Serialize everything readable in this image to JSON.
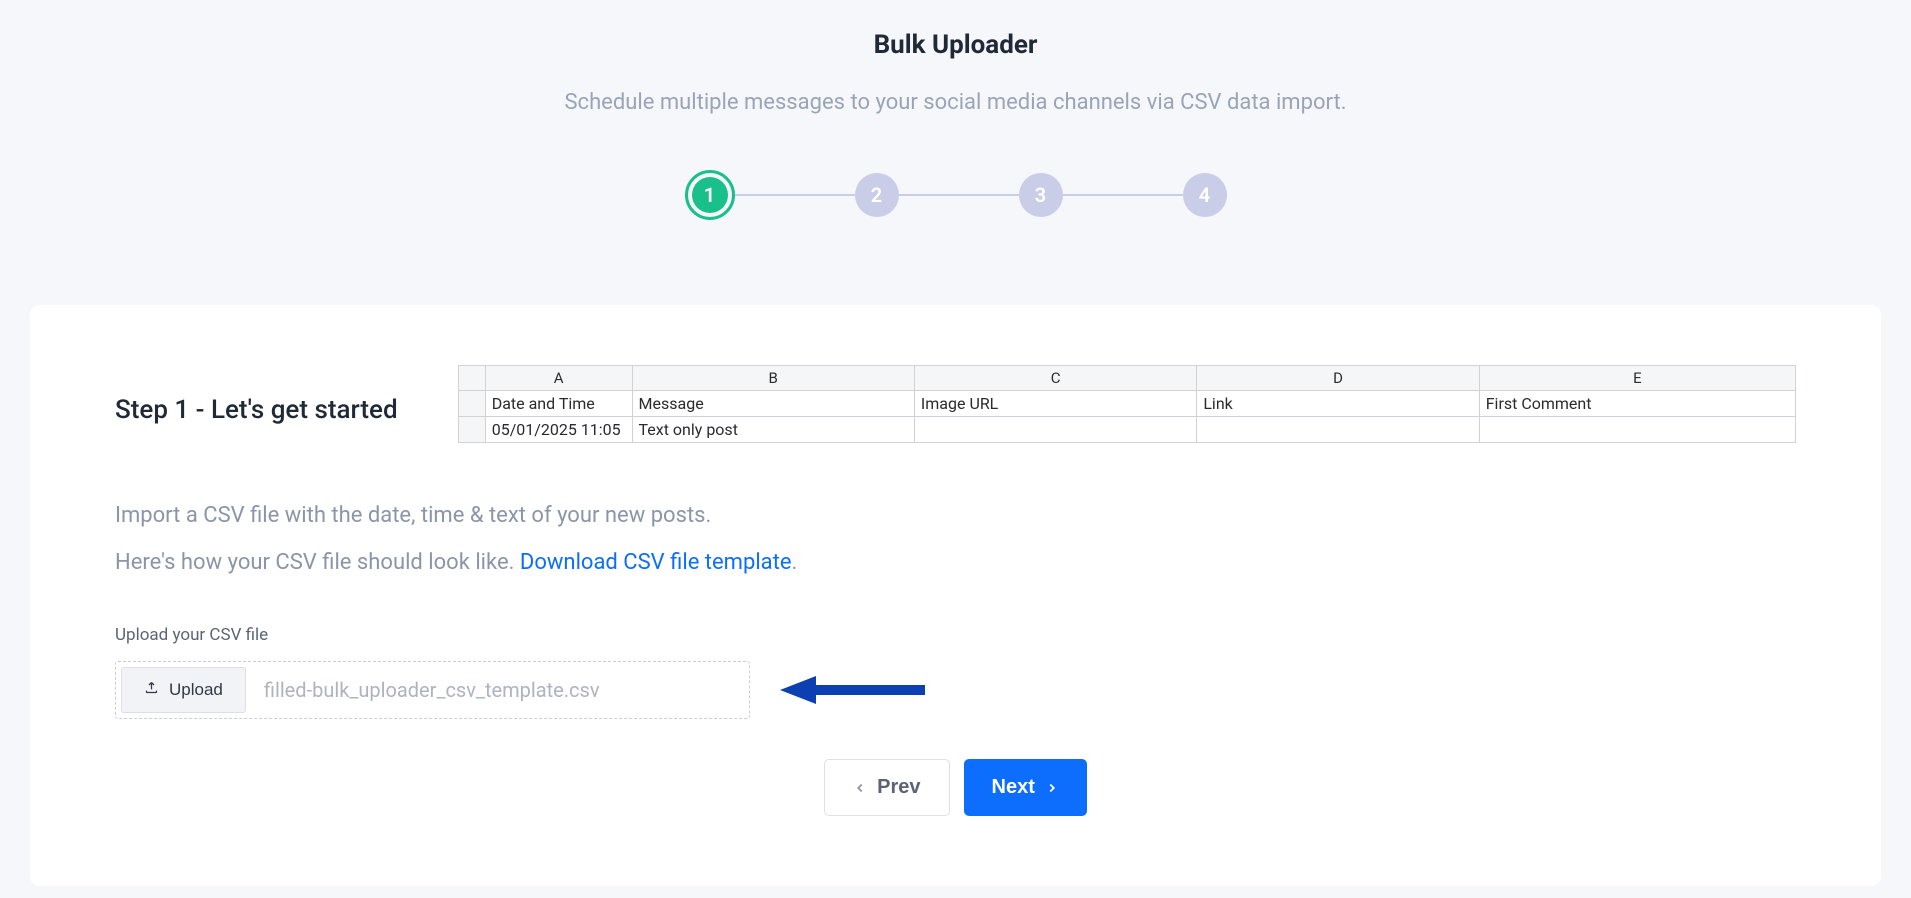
{
  "header": {
    "title": "Bulk Uploader",
    "subtitle": "Schedule multiple messages to your social media channels via CSV data import."
  },
  "stepper": {
    "steps": [
      "1",
      "2",
      "3",
      "4"
    ],
    "active": 0
  },
  "card": {
    "step_title": "Step 1 - Let's get started",
    "spreadsheet": {
      "columns": [
        "A",
        "B",
        "C",
        "D",
        "E"
      ],
      "headers": [
        "Date and Time",
        "Message",
        "Image URL",
        "Link",
        "First Comment"
      ],
      "row": [
        "05/01/2025 11:05",
        "Text only post",
        "",
        "",
        ""
      ]
    },
    "desc1": "Import a CSV file with the date, time & text of your new posts.",
    "desc2_prefix": "Here's how your CSV file should look like. ",
    "download_link": "Download CSV file template",
    "desc2_suffix": ".",
    "upload": {
      "label": "Upload your CSV file",
      "button": "Upload",
      "filename": "filled-bulk_uploader_csv_template.csv"
    },
    "nav": {
      "prev": "Prev",
      "next": "Next"
    }
  }
}
